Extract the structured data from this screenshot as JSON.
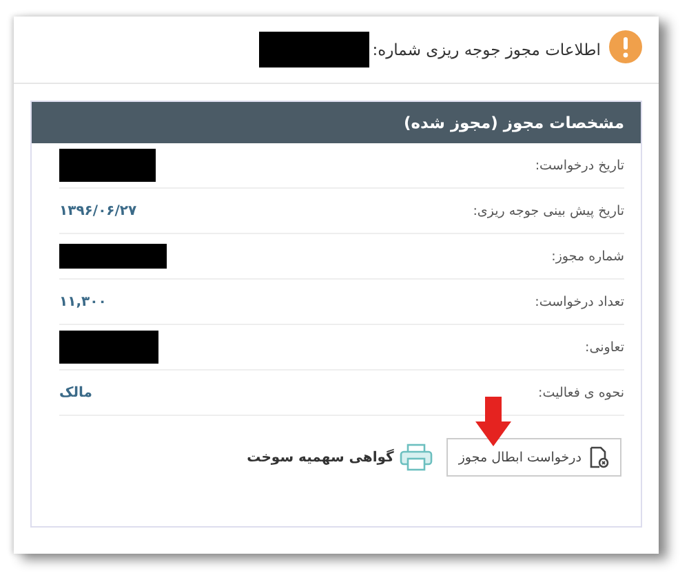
{
  "title": "اطلاعات مجوز جوجه ریزی شماره:",
  "title_redacted": true,
  "panel": {
    "heading": "مشخصات مجوز (مجوز شده)",
    "rows": [
      {
        "label": "تاریخ درخواست:",
        "kind": "redacted"
      },
      {
        "label": "تاریخ پیش بینی جوجه ریزی:",
        "kind": "text",
        "value": "۱۳۹۶/۰۶/۲۷"
      },
      {
        "label": "شماره مجوز:",
        "kind": "redacted"
      },
      {
        "label": "تعداد درخواست:",
        "kind": "text",
        "value": "۱۱,۳۰۰"
      },
      {
        "label": "تعاونی:",
        "kind": "redacted"
      },
      {
        "label": "نحوه ی فعالیت:",
        "kind": "text",
        "value": "مالک"
      }
    ]
  },
  "actions": [
    {
      "label": "درخواست ابطال مجوز",
      "kind": "button"
    },
    {
      "label": "گواهی سهمیه سوخت",
      "kind": "link"
    }
  ]
}
